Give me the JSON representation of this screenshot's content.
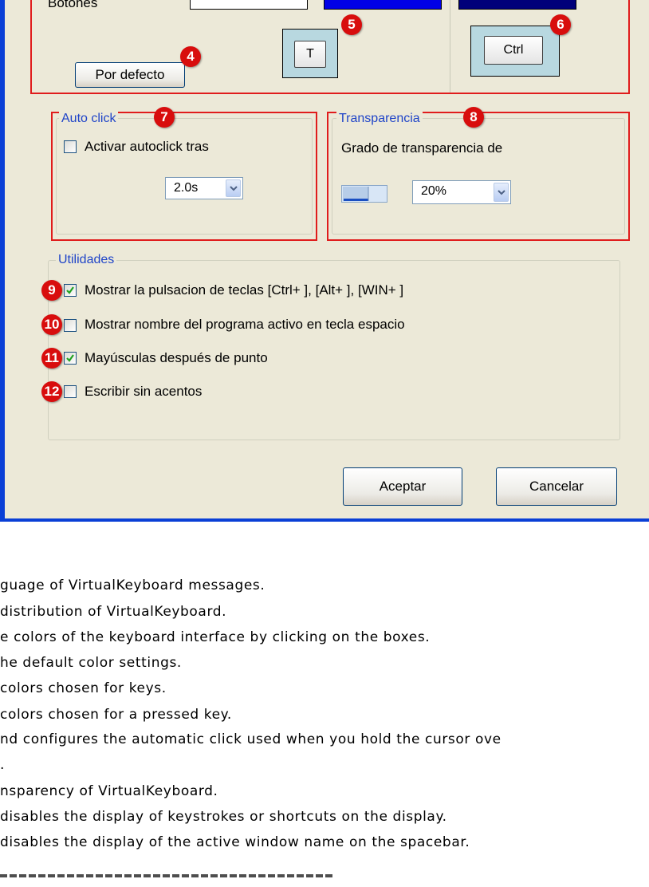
{
  "colors_section": {
    "row_label": "Botones",
    "default_button": "Por defecto",
    "key_normal_label": "T",
    "key_pressed_label": "Ctrl",
    "swatch_colors": [
      "#ffffff",
      "#0000e6",
      "#00007a"
    ]
  },
  "autoclick": {
    "legend": "Auto click",
    "checkbox_label": "Activar autoclick tras",
    "checked": false,
    "delay_value": "2.0s"
  },
  "transparency": {
    "legend": "Transparencia",
    "label": "Grado de transparencia de",
    "value": "20%"
  },
  "utilities": {
    "legend": "Utilidades",
    "items": [
      {
        "label": "Mostrar la pulsacion de teclas [Ctrl+ ], [Alt+ ], [WIN+ ]",
        "checked": true
      },
      {
        "label": "Mostrar nombre del programa activo en tecla espacio",
        "checked": false
      },
      {
        "label": "Mayúsculas después de punto",
        "checked": true
      },
      {
        "label": "Escribir sin acentos",
        "checked": false
      }
    ]
  },
  "footer": {
    "ok": "Aceptar",
    "cancel": "Cancelar"
  },
  "badges": [
    "4",
    "5",
    "6",
    "7",
    "8",
    "9",
    "10",
    "11",
    "12"
  ],
  "descriptions": [
    "guage of VirtualKeyboard messages.",
    "distribution of VirtualKeyboard.",
    "e colors of the keyboard interface by clicking on the boxes.",
    "he default color settings.",
    "colors chosen for keys.",
    "colors chosen for a pressed key.",
    "nd configures the automatic click used when you hold the cursor ove",
    ".",
    "nsparency of VirtualKeyboard.",
    "disables the display of keystrokes or shortcuts on the display.",
    "disables the display of the active window name on the spacebar."
  ],
  "accent_colors": {
    "annotation_red": "#e01c1c",
    "badge_red": "#d80d0d",
    "xp_blue": "#0a3fd6",
    "dialog_bg": "#ece9d8"
  }
}
